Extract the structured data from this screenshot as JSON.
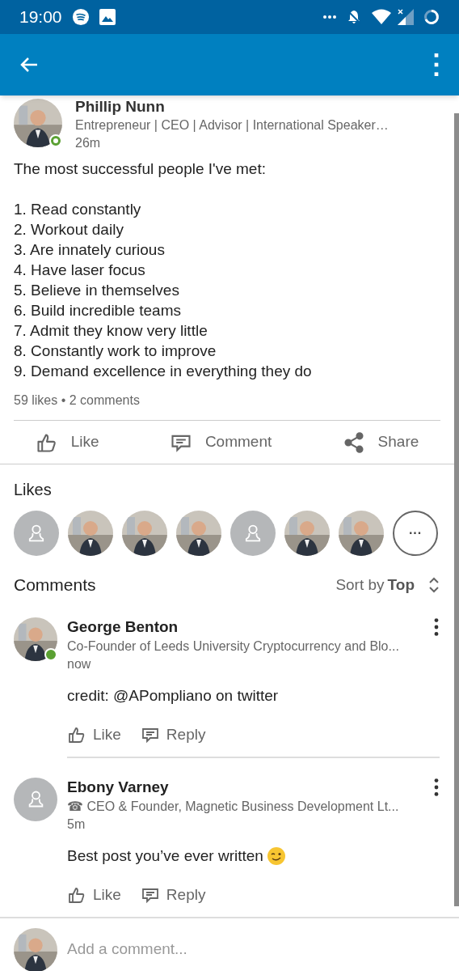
{
  "status_bar": {
    "time": "19:00"
  },
  "post": {
    "author": "Phillip Nunn",
    "headline": "Entrepreneur | CEO | Advisor | International Speaker…",
    "time": "26m",
    "online": true,
    "intro": "The most successful people I've met:",
    "lines": [
      "1. Read constantly",
      "2. Workout daily",
      "3. Are innately curious",
      "4. Have laser focus",
      "5. Believe in themselves",
      "6. Build incredible teams",
      "7. Admit they know very little",
      "8. Constantly work to improve",
      "9. Demand excellence in everything they do"
    ],
    "counts": "59 likes • 2 comments"
  },
  "actions": [
    {
      "kind": "like",
      "label": "Like"
    },
    {
      "kind": "comment",
      "label": "Comment"
    },
    {
      "kind": "share",
      "label": "Share"
    }
  ],
  "likes": {
    "title": "Likes",
    "people": [
      {
        "kind": "placeholder"
      },
      {
        "kind": "picture"
      },
      {
        "kind": "picture"
      },
      {
        "kind": "picture"
      },
      {
        "kind": "placeholder"
      },
      {
        "kind": "picture"
      },
      {
        "kind": "picture"
      },
      {
        "kind": "more",
        "label": "···"
      }
    ]
  },
  "comments": {
    "title": "Comments",
    "sort_label": "Sort by",
    "sort_value": "Top",
    "items": [
      {
        "name": "George Benton",
        "headline": "Co-Founder of Leeds University Cryptocurrency and Blo...",
        "time": "now",
        "text": "credit: @APompliano on twitter",
        "avatar": {
          "kind": "picture"
        },
        "online": true,
        "emoji": false,
        "like": "Like",
        "reply": "Reply"
      },
      {
        "name": "Ebony Varney",
        "headline": "☎ CEO & Founder, Magnetic Business Development Lt...",
        "time": "5m",
        "text": "Best post you’ve ever written",
        "avatar": {
          "kind": "placeholder"
        },
        "online": false,
        "emoji": true,
        "like": "Like",
        "reply": "Reply"
      }
    ]
  },
  "composer": {
    "placeholder": "Add a comment..."
  }
}
